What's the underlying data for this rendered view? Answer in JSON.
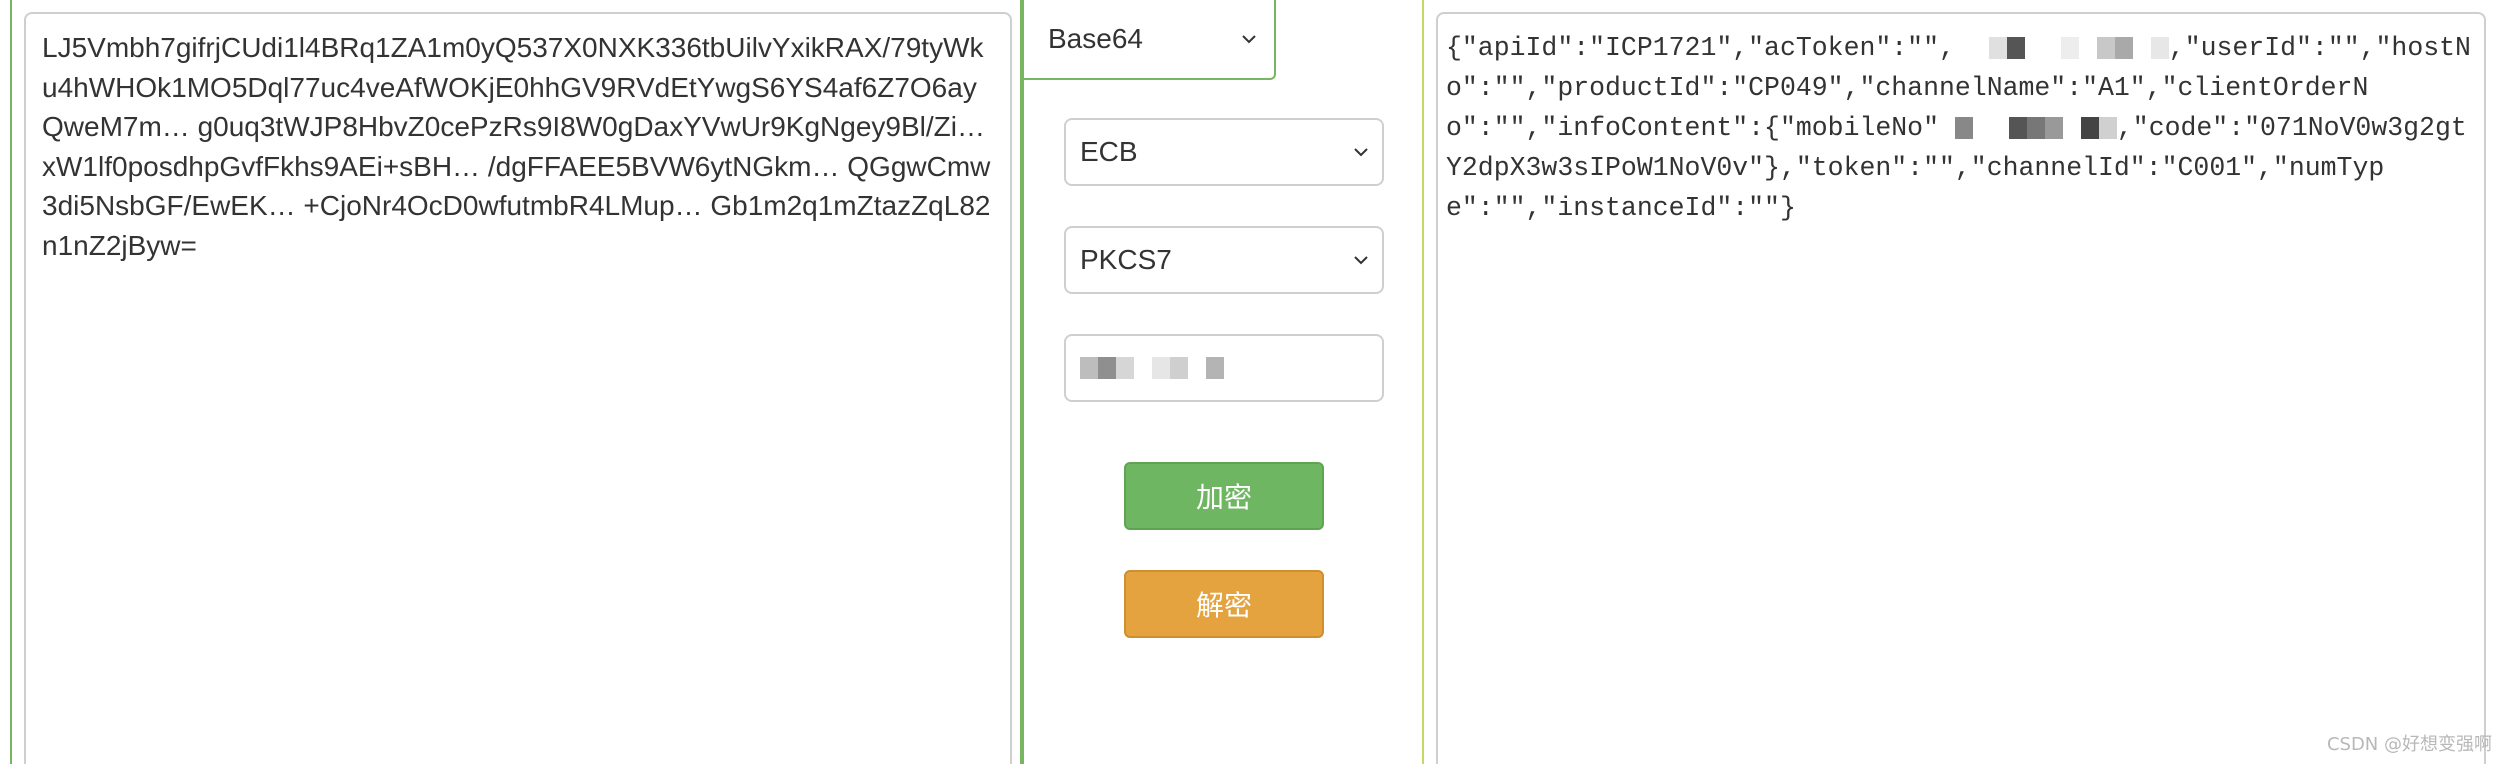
{
  "input_text": "LJ5Vmbh7gifrjCUdi1l4BRq1ZA1m0yQ537X0NXK336tbUilvYxikRAX/79tyWku4hWHOk1MO5Dql77uc4veAfWOKjE0hhGV9RVdEtYwgS6YS4af6Z7O6ayQweM7m… g0uq3tWJP8HbvZ0cePzRs9I8W0gDaxYVwUr9KgNgey9Bl/Zi… xW1lf0posdhpGvfFkhs9AEi+sBH… /dgFFAEE5BVW6ytNGkm… QGgwCmw3di5NsbGF/EwEK… +CjoNr4OcD0wfutmbR4LMup… Gb1m2q1mZtazZqL82n1nZ2jByw=",
  "controls": {
    "encoding": "Base64",
    "mode": "ECB",
    "padding": "PKCS7",
    "key_placeholder": ""
  },
  "buttons": {
    "encrypt": "加密",
    "decrypt": "解密"
  },
  "output": {
    "segment1": "{\"apiId\":\"ICP1721\",\"acToken\":\"\",",
    "segment2": ",\"userId\":\"\",\"hostNo\":\"\",\"productId\":\"CP049\",\"channelName\":\"A1\",\"clientOrderNo\":\"\",\"infoContent\":{\"mobileNo\"",
    "segment3": ",\"code\":\"071NoV0w3g2gtY2dpX3w3sIPoW1NoV0v\"},\"token\":\"\",\"channelId\":\"C001\",\"numType\":\"\",\"instanceId\":\"\"}"
  },
  "watermark": "CSDN @好想变强啊",
  "colors": {
    "panel_border_green": "#77b561",
    "panel_border_yellow": "#c9d865",
    "encrypt_bg": "#6fb662",
    "decrypt_bg": "#e4a33f"
  },
  "icons": {
    "select_arrow": "chevron-down-icon",
    "redaction": "pixel-mosaic"
  }
}
